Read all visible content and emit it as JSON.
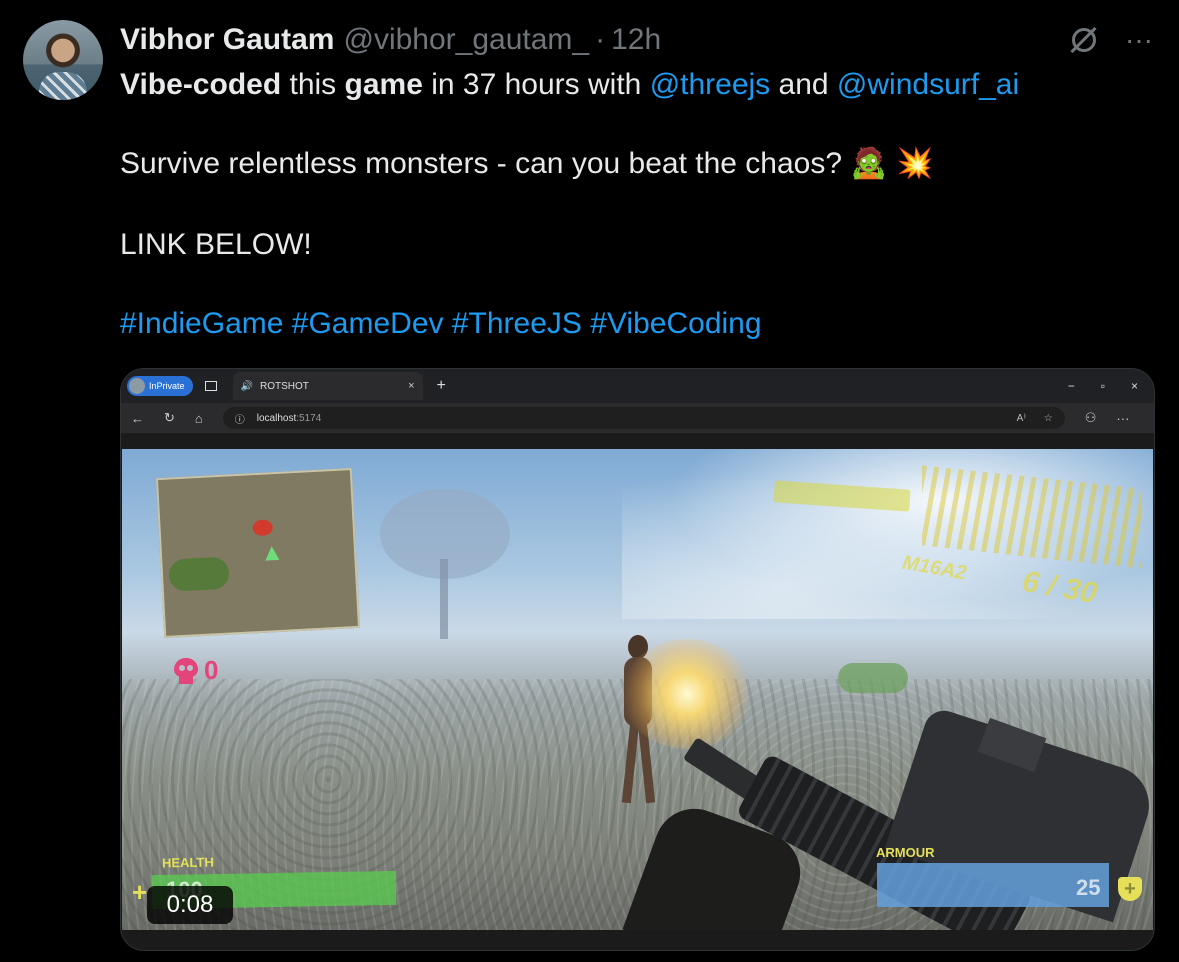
{
  "author": {
    "name": "Vibhor Gautam",
    "handle": "@vibhor_gautam_",
    "separator": "·",
    "time": "12h"
  },
  "actions": {
    "grok_icon": "nosign-icon",
    "more": "···"
  },
  "text": {
    "line1_bold1": "Vibe-coded",
    "line1_mid1": " this ",
    "line1_bold2": "game",
    "line1_mid2": " in 37 hours with ",
    "line1_mention1": "@threejs",
    "line1_mid3": " and ",
    "line1_mention2": "@windsurf_ai",
    "line2": "Survive relentless monsters - can you beat the chaos?",
    "line2_emoji": "🧟 💥",
    "line3": "LINK BELOW!",
    "hashtags": [
      "#IndieGame",
      "#GameDev",
      "#ThreeJS",
      "#VibeCoding"
    ]
  },
  "media": {
    "browser": {
      "inprivate": "InPrivate",
      "tab_title": "ROTSHOT",
      "tab_close": "×",
      "new_tab": "+",
      "min": "−",
      "restore": "▫",
      "close": "×",
      "back": "←",
      "reload": "↻",
      "home": "⌂",
      "info": "ⓘ",
      "url_host": "localhost",
      "url_port": ":5174",
      "read_aloud": "A⁾",
      "favorite": "☆",
      "extensions": "⚇",
      "menu": "···"
    },
    "game": {
      "kills": "0",
      "weapon_name": "M16A2",
      "ammo": "6 / 30",
      "health_label": "HEALTH",
      "health_value": "100",
      "health_level": 100,
      "armour_label": "ARMOUR",
      "armour_value": "25",
      "plus": "+"
    },
    "timestamp": "0:08"
  }
}
